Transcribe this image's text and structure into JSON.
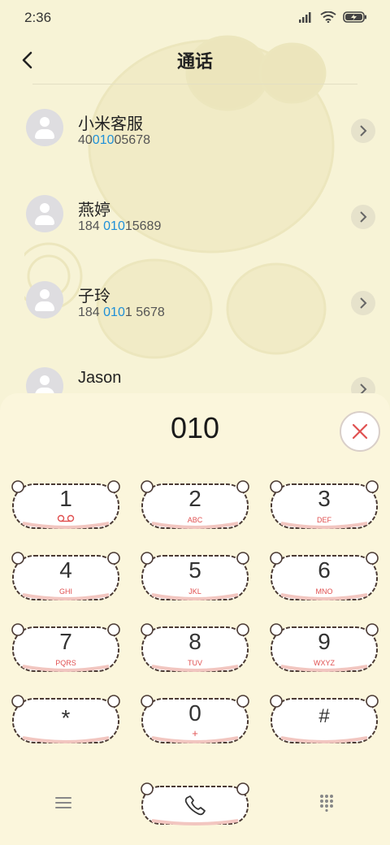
{
  "status_bar": {
    "time": "2:36",
    "icons": [
      "signal-icon",
      "wifi-icon",
      "battery-charging-icon"
    ]
  },
  "header": {
    "title": "通话",
    "back_icon": "back-arrow-icon"
  },
  "results": [
    {
      "name": "小米客服",
      "number_parts": [
        "40",
        "010",
        "05678"
      ]
    },
    {
      "name": "燕婷",
      "number_parts": [
        "184 ",
        "010",
        "15689"
      ]
    },
    {
      "name": "子玲",
      "number_parts": [
        "184 ",
        "010",
        "1 5678"
      ]
    },
    {
      "name": "Jason",
      "number_parts": [
        "",
        "",
        ""
      ]
    }
  ],
  "dialpad": {
    "input_value": "010",
    "keys": [
      {
        "digit": "1",
        "letters": "",
        "sub_icon": "voicemail-icon"
      },
      {
        "digit": "2",
        "letters": "ABC"
      },
      {
        "digit": "3",
        "letters": "DEF"
      },
      {
        "digit": "4",
        "letters": "GHI"
      },
      {
        "digit": "5",
        "letters": "JKL"
      },
      {
        "digit": "6",
        "letters": "MNO"
      },
      {
        "digit": "7",
        "letters": "PQRS"
      },
      {
        "digit": "8",
        "letters": "TUV"
      },
      {
        "digit": "9",
        "letters": "WXYZ"
      },
      {
        "digit": "*",
        "letters": ""
      },
      {
        "digit": "0",
        "letters": "+"
      },
      {
        "digit": "#",
        "letters": ""
      }
    ]
  },
  "bottom_bar": {
    "left_icon": "menu-icon",
    "call_icon": "phone-icon",
    "right_icon": "dialpad-grid-icon"
  },
  "colors": {
    "background": "#f7f3d6",
    "highlight": "#1e90d8",
    "letters": "#e05050",
    "key_border": "#4a3a34"
  }
}
